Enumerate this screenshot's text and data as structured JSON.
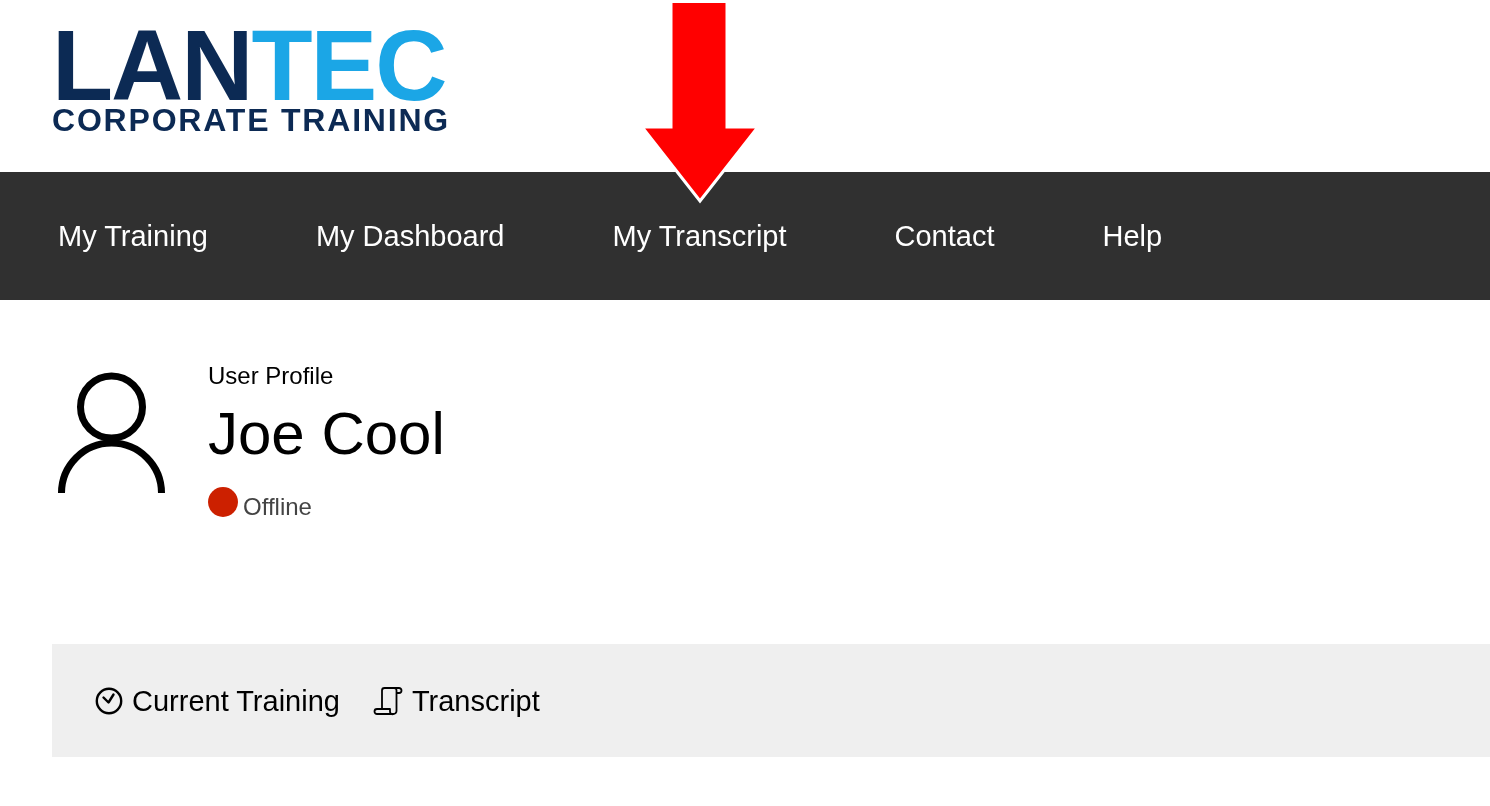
{
  "logo": {
    "parts": [
      {
        "text": "LAN",
        "color": "#0c2a54"
      },
      {
        "text": "TEC",
        "color": "#1ba6e6"
      }
    ],
    "tagline": "CORPORATE TRAINING"
  },
  "nav": {
    "items": [
      {
        "label": "My Training",
        "annotated": false
      },
      {
        "label": "My Dashboard",
        "annotated": false
      },
      {
        "label": "My Transcript",
        "annotated": true
      },
      {
        "label": "Contact",
        "annotated": false
      },
      {
        "label": "Help",
        "annotated": false
      }
    ]
  },
  "profile": {
    "heading": "User Profile",
    "name": "Joe Cool",
    "status": {
      "label": "Offline",
      "online": false
    }
  },
  "tabs": [
    {
      "label": "Current Training",
      "kind": "current"
    },
    {
      "label": "Transcript",
      "kind": "history"
    }
  ]
}
